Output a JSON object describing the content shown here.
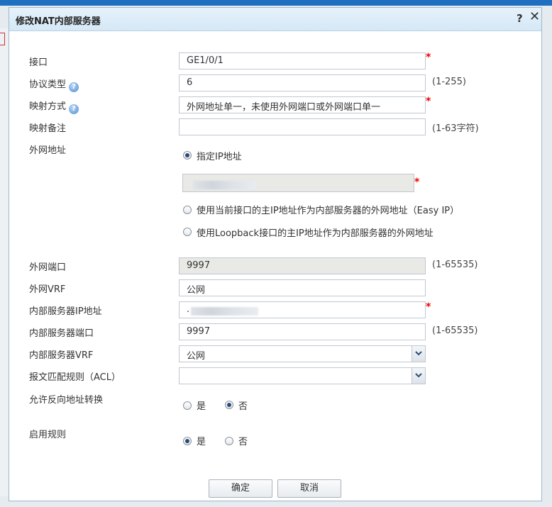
{
  "dialog": {
    "title": "修改NAT内部服务器",
    "help": "?",
    "close": "✕"
  },
  "form": {
    "interface": {
      "label": "接口",
      "value": "GE1/0/1"
    },
    "protocol": {
      "label": "协议类型",
      "value": "6",
      "hint": "(1-255)"
    },
    "mapping_mode": {
      "label": "映射方式",
      "value": "外网地址单一，未使用外网端口或外网端口单一"
    },
    "mapping_note": {
      "label": "映射备注",
      "value": "",
      "hint": "(1-63字符)"
    },
    "public_address": {
      "label": "外网地址",
      "options": [
        {
          "label": "指定IP地址",
          "selected": true
        },
        {
          "label": "使用当前接口的主IP地址作为内部服务器的外网地址（Easy IP）",
          "selected": false
        },
        {
          "label": "使用Loopback接口的主IP地址作为内部服务器的外网地址",
          "selected": false
        }
      ],
      "ip_value": ""
    },
    "public_port": {
      "label": "外网端口",
      "value": "9997",
      "hint": "(1-65535)"
    },
    "public_vrf": {
      "label": "外网VRF",
      "value": "公网"
    },
    "internal_ip": {
      "label": "内部服务器IP地址",
      "value": "."
    },
    "internal_port": {
      "label": "内部服务器端口",
      "value": "9997",
      "hint": "(1-65535)"
    },
    "internal_vrf": {
      "label": "内部服务器VRF",
      "value": "公网"
    },
    "acl": {
      "label": "报文匹配规则（ACL）",
      "value": ""
    },
    "reverse_nat": {
      "label": "允许反向地址转换",
      "options": [
        {
          "label": "是",
          "selected": false
        },
        {
          "label": "否",
          "selected": true
        }
      ]
    },
    "enable_rule": {
      "label": "启用规则",
      "options": [
        {
          "label": "是",
          "selected": true
        },
        {
          "label": "否",
          "selected": false
        }
      ]
    },
    "required_mark": "*"
  },
  "buttons": {
    "ok": "确定",
    "cancel": "取消"
  },
  "colors": {
    "title_bar": "#d5e8f6",
    "top_bar": "#1f6fc1",
    "required": "#e00000",
    "help_icon": "#4f8ed6"
  }
}
